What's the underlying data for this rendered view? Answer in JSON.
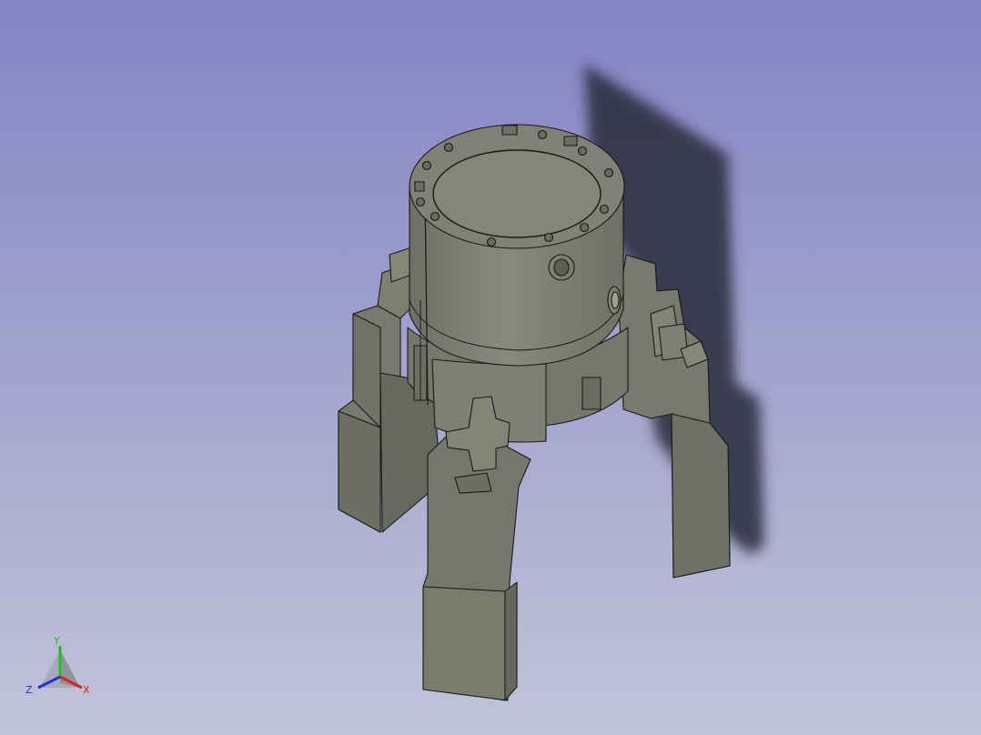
{
  "view": {
    "background_top": "#8583c4",
    "background_bottom": "#c1c4d8",
    "model_color": "#7a7c6e",
    "model_edge_color": "#1a1a1a",
    "shadow_color": "#2a2a38"
  },
  "axis_triad": {
    "y_label": "Y",
    "x_label": "X",
    "z_label": "Z",
    "x_color": "#e02020",
    "y_color": "#20c020",
    "z_color": "#2030e0"
  }
}
